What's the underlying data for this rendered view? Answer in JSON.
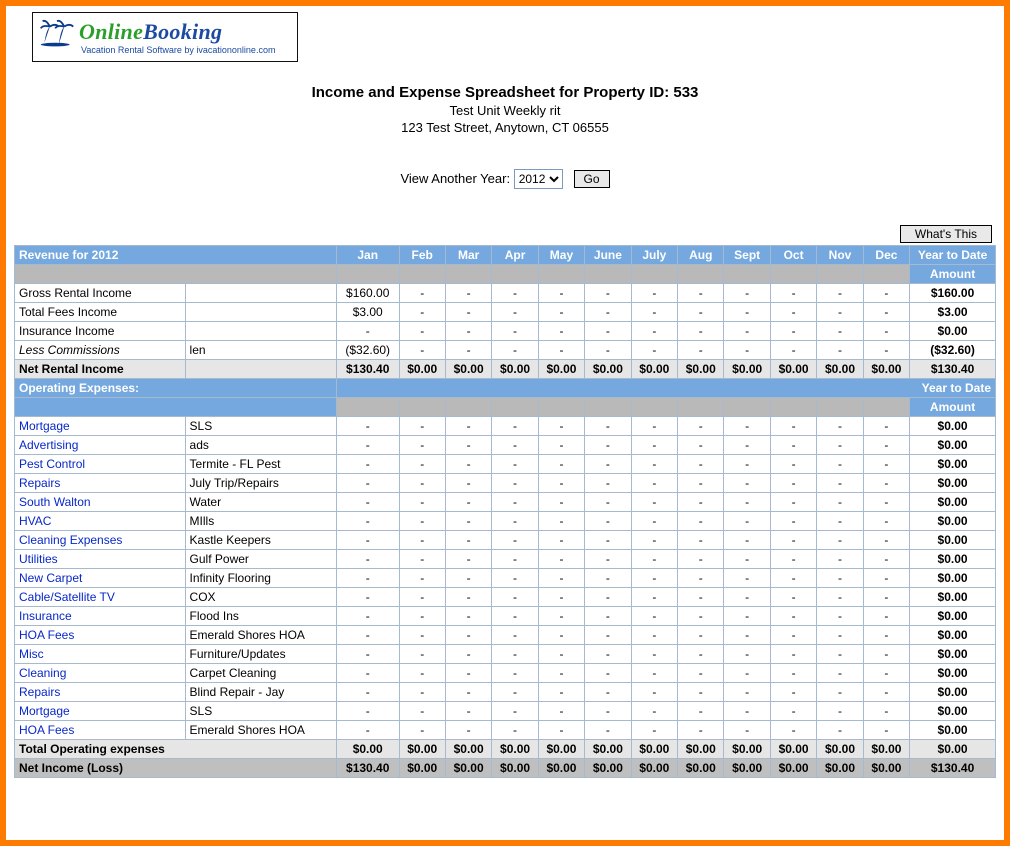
{
  "logo": {
    "brand1": "Online",
    "brand2": "Booking",
    "sub": "Vacation Rental Software by ivacationonline.com"
  },
  "header": {
    "title": "Income and Expense Spreadsheet for Property ID: 533",
    "unit": "Test Unit Weekly rit",
    "address": "123 Test Street, Anytown, CT 06555"
  },
  "viewRow": {
    "label": "View Another Year:",
    "selected": "2012",
    "go": "Go"
  },
  "whats": "What's This",
  "months": [
    "Jan",
    "Feb",
    "Mar",
    "Apr",
    "May",
    "June",
    "July",
    "Aug",
    "Sept",
    "Oct",
    "Nov",
    "Dec"
  ],
  "revenueHeader": "Revenue for 2012",
  "ytdLabel": "Year to Date",
  "amountLabel": "Amount",
  "revenue": [
    {
      "name": "Gross Rental Income",
      "vendor": "",
      "vals": [
        "$160.00",
        "-",
        "-",
        "-",
        "-",
        "-",
        "-",
        "-",
        "-",
        "-",
        "-",
        "-"
      ],
      "ytd": "$160.00"
    },
    {
      "name": "Total Fees Income",
      "vendor": "",
      "vals": [
        "$3.00",
        "-",
        "-",
        "-",
        "-",
        "-",
        "-",
        "-",
        "-",
        "-",
        "-",
        "-"
      ],
      "ytd": "$3.00"
    },
    {
      "name": "Insurance Income",
      "vendor": "",
      "vals": [
        "-",
        "-",
        "-",
        "-",
        "-",
        "-",
        "-",
        "-",
        "-",
        "-",
        "-",
        "-"
      ],
      "ytd": "$0.00"
    },
    {
      "name": "Less Commissions",
      "vendor": "len",
      "italic": true,
      "vals": [
        "($32.60)",
        "-",
        "-",
        "-",
        "-",
        "-",
        "-",
        "-",
        "-",
        "-",
        "-",
        "-"
      ],
      "ytd": "($32.60)"
    }
  ],
  "netRental": {
    "name": "Net Rental Income",
    "vals": [
      "$130.40",
      "$0.00",
      "$0.00",
      "$0.00",
      "$0.00",
      "$0.00",
      "$0.00",
      "$0.00",
      "$0.00",
      "$0.00",
      "$0.00",
      "$0.00"
    ],
    "ytd": "$130.40"
  },
  "opHeader": "Operating Expenses:",
  "expenses": [
    {
      "name": "Mortgage",
      "vendor": "SLS"
    },
    {
      "name": "Advertising",
      "vendor": "ads"
    },
    {
      "name": "Pest Control",
      "vendor": "Termite - FL Pest"
    },
    {
      "name": "Repairs",
      "vendor": "July Trip/Repairs"
    },
    {
      "name": "South Walton",
      "vendor": "Water"
    },
    {
      "name": "HVAC",
      "vendor": "MIlls"
    },
    {
      "name": "Cleaning Expenses",
      "vendor": "Kastle Keepers"
    },
    {
      "name": "Utilities",
      "vendor": "Gulf Power"
    },
    {
      "name": "New Carpet",
      "vendor": "Infinity Flooring"
    },
    {
      "name": "Cable/Satellite TV",
      "vendor": "COX"
    },
    {
      "name": "Insurance",
      "vendor": "Flood Ins"
    },
    {
      "name": "HOA Fees",
      "vendor": "Emerald Shores HOA"
    },
    {
      "name": "Misc",
      "vendor": "Furniture/Updates"
    },
    {
      "name": "Cleaning",
      "vendor": "Carpet Cleaning"
    },
    {
      "name": "Repairs",
      "vendor": "Blind Repair - Jay"
    },
    {
      "name": "Mortgage",
      "vendor": "SLS"
    },
    {
      "name": "HOA Fees",
      "vendor": "Emerald Shores HOA"
    }
  ],
  "expenseVals": [
    "-",
    "-",
    "-",
    "-",
    "-",
    "-",
    "-",
    "-",
    "-",
    "-",
    "-",
    "-"
  ],
  "expenseYtd": "$0.00",
  "totalOp": {
    "name": "Total Operating expenses",
    "vals": [
      "$0.00",
      "$0.00",
      "$0.00",
      "$0.00",
      "$0.00",
      "$0.00",
      "$0.00",
      "$0.00",
      "$0.00",
      "$0.00",
      "$0.00",
      "$0.00"
    ],
    "ytd": "$0.00"
  },
  "netIncome": {
    "name": "Net Income (Loss)",
    "vals": [
      "$130.40",
      "$0.00",
      "$0.00",
      "$0.00",
      "$0.00",
      "$0.00",
      "$0.00",
      "$0.00",
      "$0.00",
      "$0.00",
      "$0.00",
      "$0.00"
    ],
    "ytd": "$130.40"
  }
}
